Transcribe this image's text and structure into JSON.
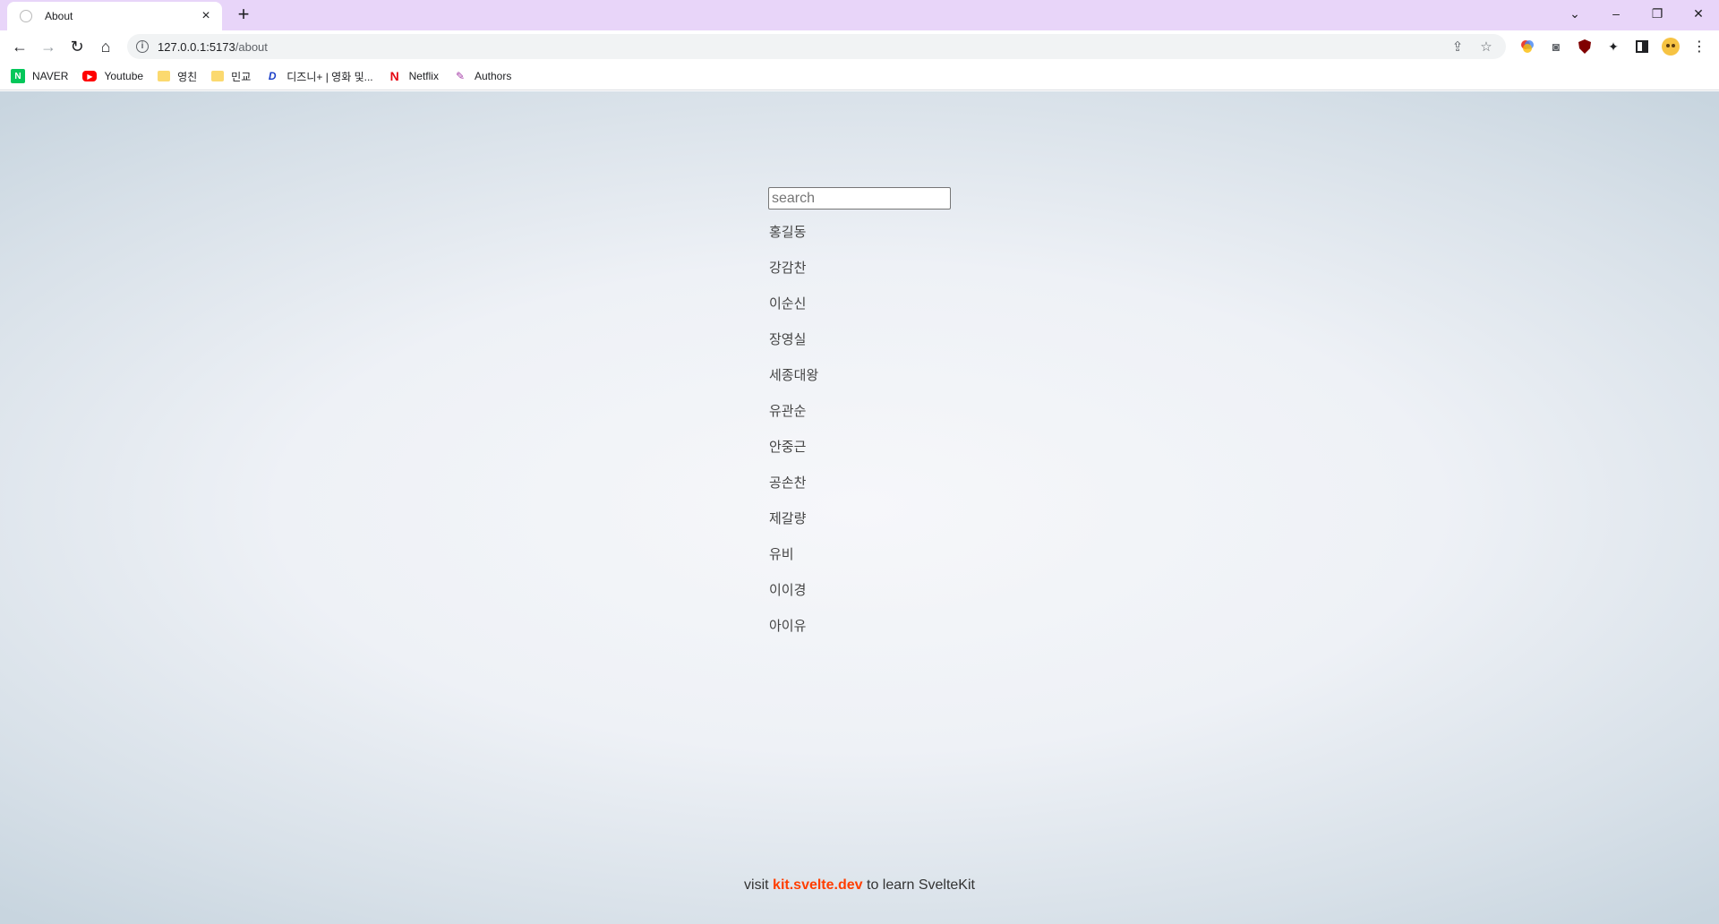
{
  "browser": {
    "tab": {
      "title": "About",
      "close_label": "×"
    },
    "new_tab_label": "+",
    "window_controls": {
      "tabs_menu": "⌄",
      "minimize": "–",
      "restore": "❐",
      "close": "✕"
    },
    "nav": {
      "back": "←",
      "forward": "→",
      "reload": "↻",
      "home": "⌂"
    },
    "address": {
      "host": "127.0.0.1:5173",
      "path": "/about"
    },
    "bookmarks": [
      {
        "label": "NAVER",
        "icon": "N"
      },
      {
        "label": "Youtube",
        "icon": "▶"
      },
      {
        "label": "영친",
        "icon": ""
      },
      {
        "label": "민교",
        "icon": ""
      },
      {
        "label": "디즈니+ | 영화 및...",
        "icon": "D"
      },
      {
        "label": "Netflix",
        "icon": "N"
      },
      {
        "label": "Authors",
        "icon": "✎"
      }
    ]
  },
  "page": {
    "search": {
      "placeholder": "search",
      "value": ""
    },
    "people": [
      "홍길동",
      "강감찬",
      "이순신",
      "장영실",
      "세종대왕",
      "유관순",
      "안중근",
      "공손찬",
      "제갈량",
      "유비",
      "이이경",
      "아이유"
    ],
    "footer": {
      "prefix": "visit",
      "link": "kit.svelte.dev",
      "suffix": "to learn SvelteKit",
      "link_color": "#ff3e00"
    }
  }
}
